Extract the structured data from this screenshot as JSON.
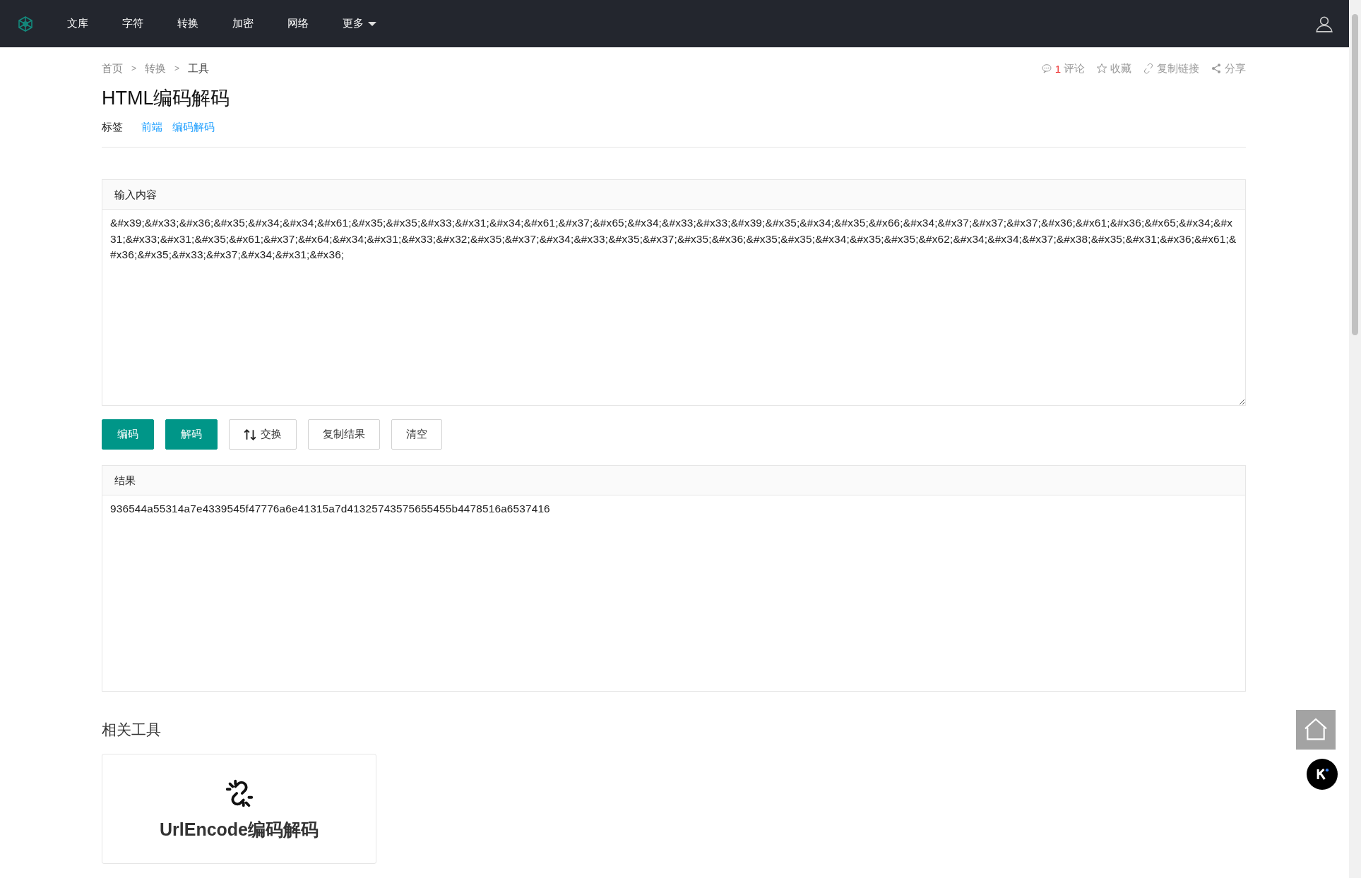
{
  "navbar": {
    "items": [
      {
        "label": "文库",
        "dropdown": false
      },
      {
        "label": "字符",
        "dropdown": false
      },
      {
        "label": "转换",
        "dropdown": false
      },
      {
        "label": "加密",
        "dropdown": false
      },
      {
        "label": "网络",
        "dropdown": false
      },
      {
        "label": "更多",
        "dropdown": true
      }
    ]
  },
  "breadcrumb": {
    "separator": ">",
    "items": [
      "首页",
      "转换",
      "工具"
    ]
  },
  "actions": {
    "comments_count": "1",
    "comments_label": "评论",
    "favorite": "收藏",
    "copy_link": "复制链接",
    "share": "分享"
  },
  "title": "HTML编码解码",
  "tags": {
    "label": "标签",
    "items": [
      "前端",
      "编码解码"
    ]
  },
  "input_panel": {
    "header": "输入内容",
    "value": "&#x39;&#x33;&#x36;&#x35;&#x34;&#x34;&#x61;&#x35;&#x35;&#x33;&#x31;&#x34;&#x61;&#x37;&#x65;&#x34;&#x33;&#x33;&#x39;&#x35;&#x34;&#x35;&#x66;&#x34;&#x37;&#x37;&#x37;&#x36;&#x61;&#x36;&#x65;&#x34;&#x31;&#x33;&#x31;&#x35;&#x61;&#x37;&#x64;&#x34;&#x31;&#x33;&#x32;&#x35;&#x37;&#x34;&#x33;&#x35;&#x37;&#x35;&#x36;&#x35;&#x35;&#x34;&#x35;&#x35;&#x62;&#x34;&#x34;&#x37;&#x38;&#x35;&#x31;&#x36;&#x61;&#x36;&#x35;&#x33;&#x37;&#x34;&#x31;&#x36;"
  },
  "buttons": [
    {
      "label": "编码",
      "kind": "primary"
    },
    {
      "label": "解码",
      "kind": "primary"
    },
    {
      "label": "交换",
      "kind": "swap"
    },
    {
      "label": "复制结果",
      "kind": "plain"
    },
    {
      "label": "清空",
      "kind": "plain"
    }
  ],
  "result_panel": {
    "header": "结果",
    "value": "936544a55314a7e4339545f47776a6e41315a7d41325743575655455b4478516a6537416"
  },
  "related": {
    "heading": "相关工具",
    "tools": [
      {
        "name": "UrlEncode编码解码"
      }
    ]
  }
}
